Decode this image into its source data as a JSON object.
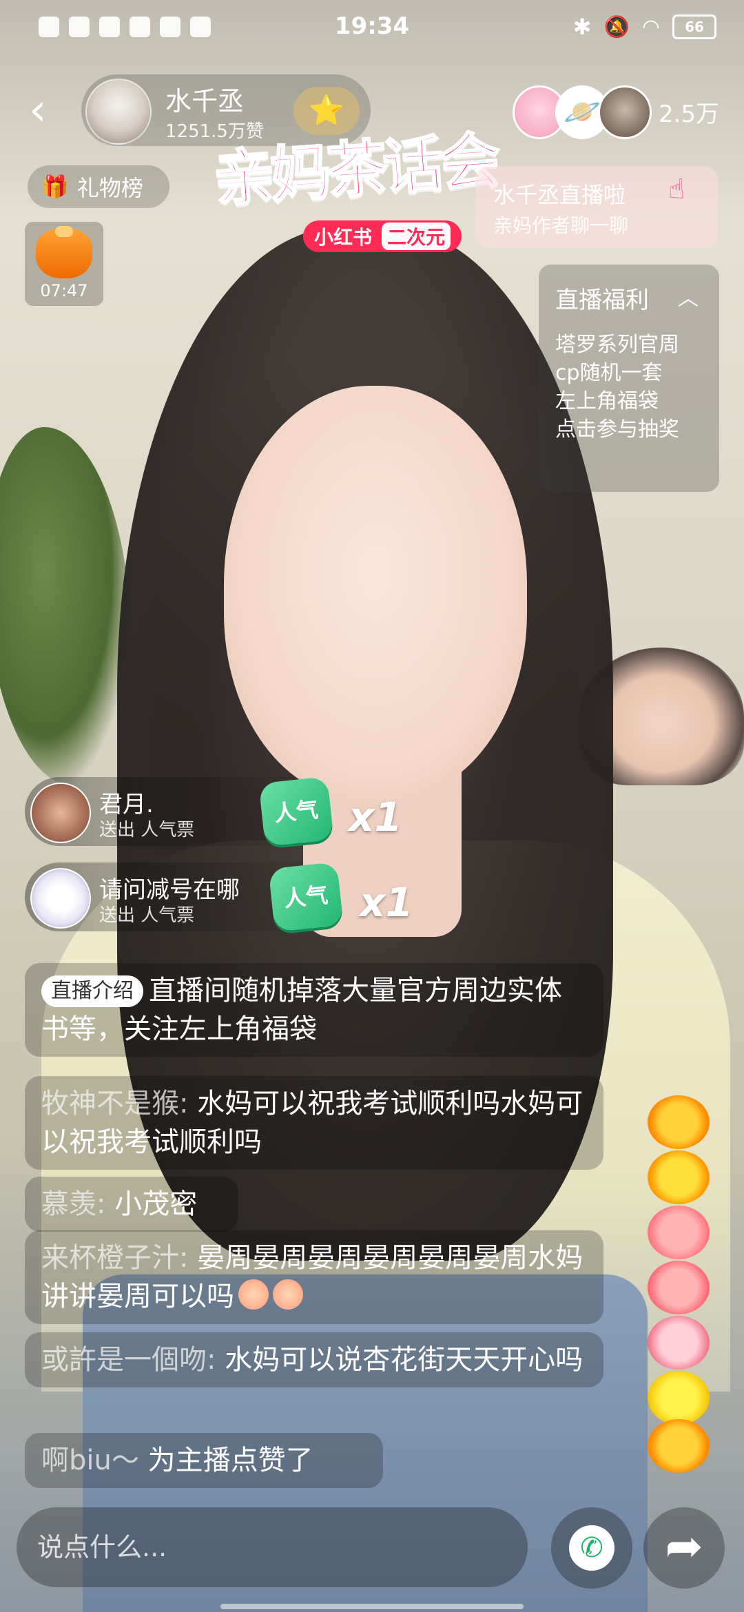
{
  "status_bar": {
    "time": "19:34",
    "battery": "66"
  },
  "header": {
    "host_name": "水千丞",
    "host_likes": "1251.5万赞",
    "viewer_count": "2.5万",
    "gift_rank_label": "礼物榜",
    "fukubag_timer": "07:47"
  },
  "event": {
    "title": "亲妈茶话会",
    "sub_brand": "小红书",
    "sub_tag": "二次元",
    "notice_line1": "水千丞直播啦",
    "notice_line2": "亲妈作者聊一聊"
  },
  "welfare": {
    "title": "直播福利",
    "lines": "塔罗系列官周\ncp随机一套\n左上角福袋\n点击参与抽奖"
  },
  "gift_toasts": [
    {
      "name": "君月.",
      "action": "送出 人气票",
      "gift": "人气",
      "count": "x1"
    },
    {
      "name": "请问减号在哪",
      "action": "送出 人气票",
      "gift": "人气",
      "count": "x1"
    }
  ],
  "chat": {
    "intro_tag": "直播介绍",
    "intro_text": "直播间随机掉落大量官方周边实体书等，关注左上角福袋",
    "messages": [
      {
        "user": "牧神不是猴:",
        "text": " 水妈可以祝我考试顺利吗水妈可以祝我考试顺利吗"
      },
      {
        "user": "慕羡:",
        "text": " 小茂密"
      },
      {
        "user": "来杯橙子汁:",
        "text": " 晏周晏周晏周晏周晏周晏周水妈讲讲晏周可以吗"
      },
      {
        "user": "或許是一個吻:",
        "text": " 水妈可以说杏花街天天开心吗"
      }
    ],
    "like_user": "啊biu～",
    "like_text": " 为主播点赞了"
  },
  "bottom": {
    "input_placeholder": "说点什么..."
  },
  "colors": {
    "accent": "#ff2b55",
    "gift_green": "#23b673"
  }
}
